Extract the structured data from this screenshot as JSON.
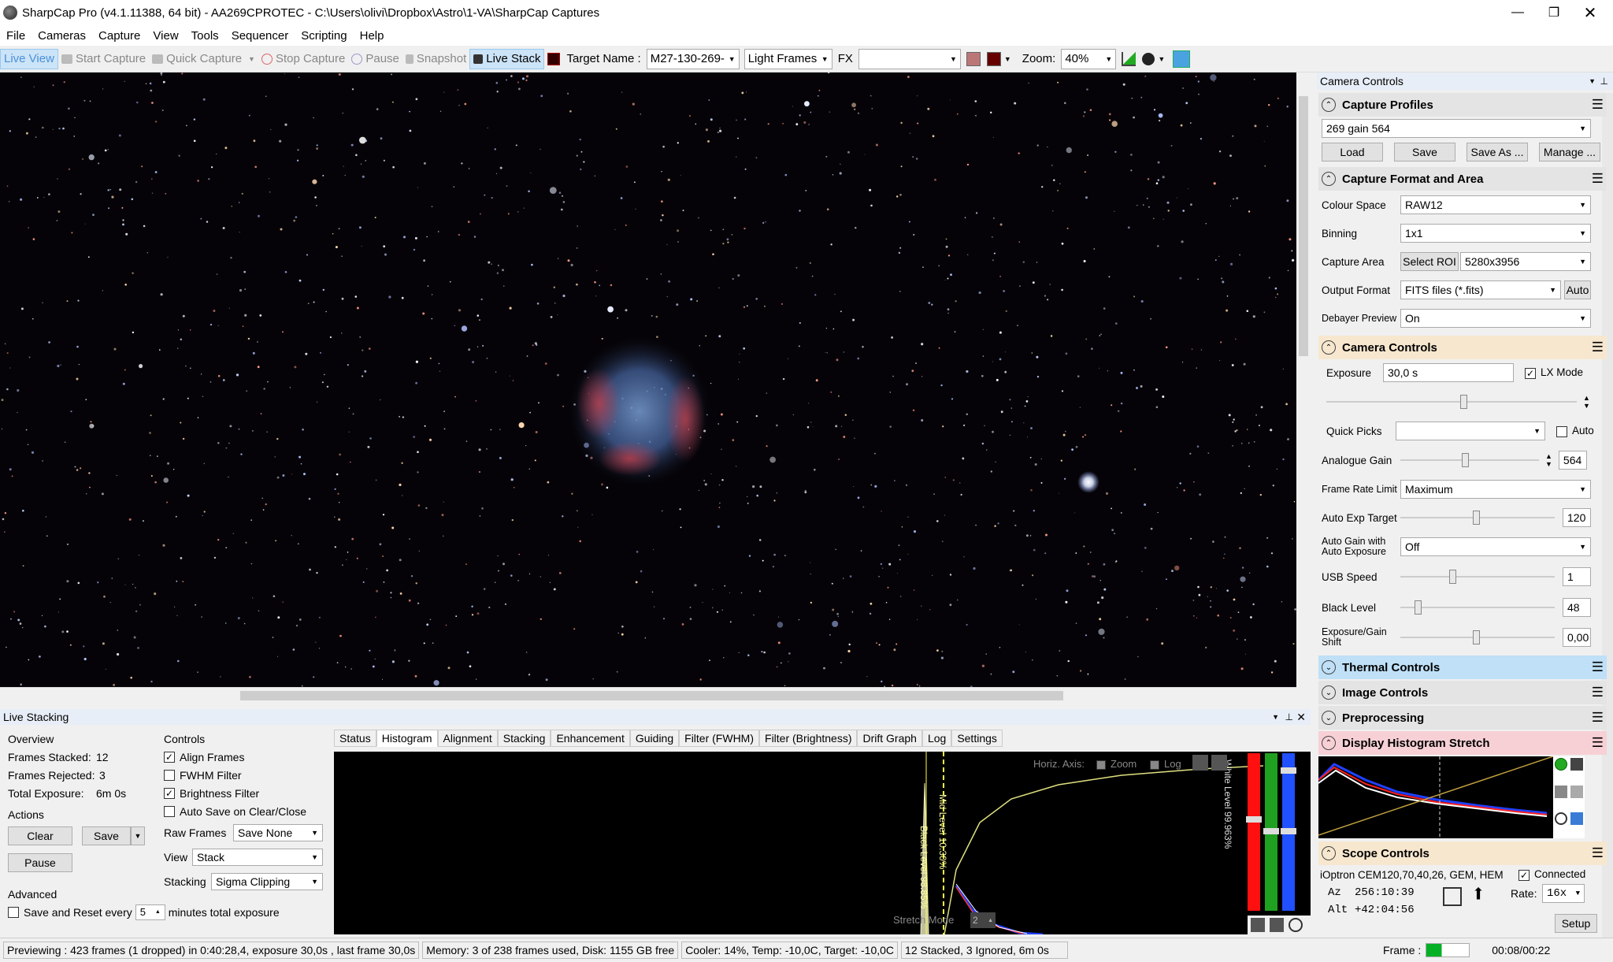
{
  "window": {
    "title": "SharpCap Pro (v4.1.11388, 64 bit) - AA269CPROTEC - C:\\Users\\olivi\\Dropbox\\Astro\\1-VA\\SharpCap Captures"
  },
  "menu": [
    "File",
    "Cameras",
    "Capture",
    "View",
    "Tools",
    "Sequencer",
    "Scripting",
    "Help"
  ],
  "toolbar": {
    "live_view": "Live View",
    "start_capture": "Start Capture",
    "quick_capture": "Quick Capture",
    "stop_capture": "Stop Capture",
    "pause": "Pause",
    "snapshot": "Snapshot",
    "live_stack": "Live Stack",
    "target_label": "Target Name :",
    "target_value": "M27-130-269-",
    "frame_type": "Light Frames",
    "fx_label": "FX",
    "fx_value": "",
    "zoom_label": "Zoom:",
    "zoom_value": "40%"
  },
  "camera_controls": {
    "title": "Camera Controls",
    "capture_profiles": {
      "title": "Capture Profiles",
      "profile": "269 gain 564",
      "load": "Load",
      "save": "Save",
      "save_as": "Save As ...",
      "manage": "Manage ..."
    },
    "format": {
      "title": "Capture Format and Area",
      "colour_space_label": "Colour Space",
      "colour_space": "RAW12",
      "binning_label": "Binning",
      "binning": "1x1",
      "capture_area_label": "Capture Area",
      "select_roi": "Select ROI",
      "capture_area": "5280x3956",
      "output_format_label": "Output Format",
      "output_format": "FITS files (*.fits)",
      "auto": "Auto",
      "debayer_label": "Debayer Preview",
      "debayer": "On"
    },
    "camera": {
      "title": "Camera Controls",
      "exposure_label": "Exposure",
      "exposure": "30,0 s",
      "lx_mode": "LX Mode",
      "quick_picks_label": "Quick Picks",
      "quick_picks": "",
      "auto": "Auto",
      "analogue_gain_label": "Analogue Gain",
      "analogue_gain": "564",
      "frame_rate_label": "Frame Rate Limit",
      "frame_rate": "Maximum",
      "auto_exp_label": "Auto Exp Target",
      "auto_exp": "120",
      "auto_gain_label": "Auto Gain with Auto Exposure",
      "auto_gain": "Off",
      "usb_label": "USB Speed",
      "usb": "1",
      "black_level_label": "Black Level",
      "black_level": "48",
      "exp_gain_shift_label": "Exposure/Gain Shift",
      "exp_gain_shift": "0,00"
    },
    "thermal": "Thermal Controls",
    "image": "Image Controls",
    "preprocessing": "Preprocessing",
    "display_histogram": "Display Histogram Stretch",
    "scope": {
      "title": "Scope Controls",
      "mount": "iOptron CEM120,70,40,26, GEM, HEM",
      "connected": "Connected",
      "az_label": "Az",
      "az": "256:10:39",
      "alt_label": "Alt",
      "alt": "+42:04:56",
      "rate_label": "Rate:",
      "rate": "16x",
      "setup": "Setup"
    }
  },
  "live_stacking": {
    "title": "Live Stacking",
    "overview": {
      "title": "Overview",
      "stacked_label": "Frames Stacked:",
      "stacked": "12",
      "rejected_label": "Frames Rejected:",
      "rejected": "3",
      "exposure_label": "Total Exposure:",
      "exposure": "6m 0s"
    },
    "actions": {
      "title": "Actions",
      "clear": "Clear",
      "save": "Save",
      "pause": "Pause"
    },
    "advanced": {
      "title": "Advanced",
      "save_reset": "Save and Reset every",
      "minutes": "5",
      "suffix": "minutes total exposure"
    },
    "controls": {
      "title": "Controls",
      "align": "Align Frames",
      "fwhm": "FWHM Filter",
      "brightness": "Brightness Filter",
      "autosave": "Auto Save on Clear/Close",
      "raw_label": "Raw Frames",
      "raw": "Save None",
      "view_label": "View",
      "view": "Stack",
      "stacking_label": "Stacking",
      "stacking": "Sigma Clipping"
    },
    "tabs": [
      "Status",
      "Histogram",
      "Alignment",
      "Stacking",
      "Enhancement",
      "Guiding",
      "Filter (FWHM)",
      "Filter (Brightness)",
      "Drift Graph",
      "Log",
      "Settings"
    ],
    "histogram": {
      "horiz_axis": "Horiz. Axis:",
      "zoom": "Zoom",
      "log": "Log",
      "black_level": "Black Level 98.85%",
      "mid_level": "Mid Level 10.30%",
      "white_level": "White Level 99.963%",
      "stretch_mode": "Stretch Mode",
      "stretch_value": "2"
    }
  },
  "status": {
    "preview": "Previewing : 423 frames (1 dropped) in 0:40:28,4, exposure 30,0s , last frame 30,0s",
    "memory": "Memory: 3 of 238 frames used, Disk: 1155 GB free",
    "cooler": "Cooler: 14%, Temp: -10,0C, Target: -10,0C",
    "stack": "12 Stacked, 3 Ignored, 6m 0s",
    "frame_label": "Frame :",
    "time": "00:08/00:22"
  }
}
